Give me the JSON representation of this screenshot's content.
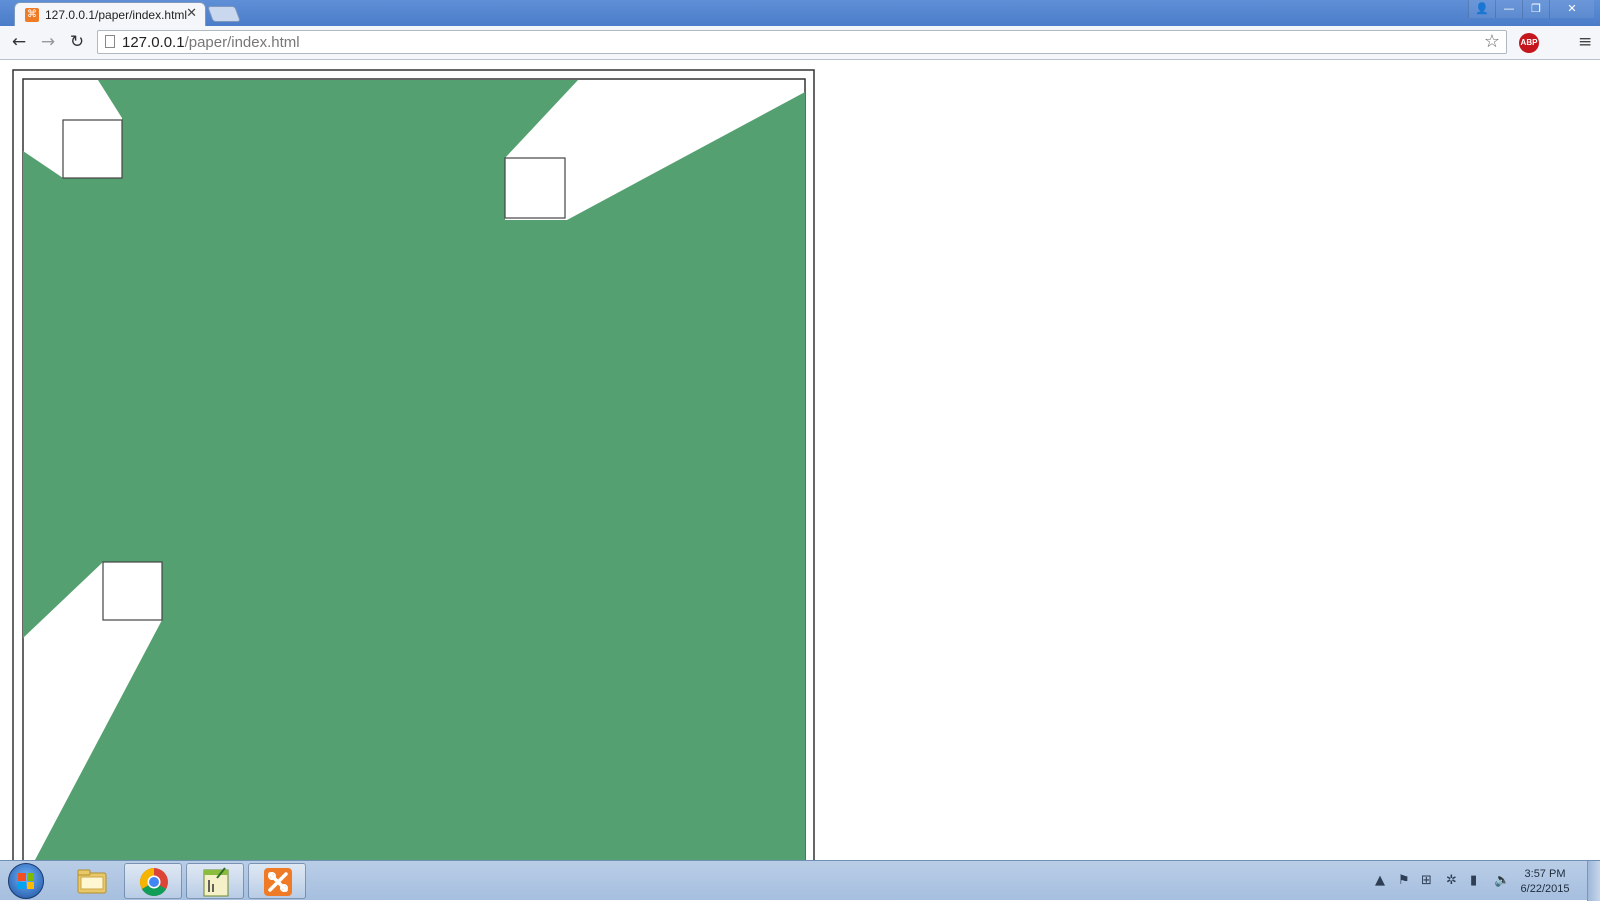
{
  "browser": {
    "tab": {
      "title": "127.0.0.1/paper/index.html",
      "favicon": "xampp-icon",
      "close_glyph": "✕"
    },
    "window_controls": {
      "profile_glyph": "👤",
      "minimize_glyph": "—",
      "restore_glyph": "❐",
      "close_glyph": "✕"
    },
    "toolbar": {
      "back_glyph": "←",
      "forward_glyph": "→",
      "reload_glyph": "↻",
      "url_host": "127.0.0.1",
      "url_path": "/paper/index.html",
      "star_glyph": "☆",
      "abp_label": "ABP",
      "menu_glyph": "≡"
    }
  },
  "page": {
    "background_color": "#ffffff",
    "green_color": "#55a070",
    "border_color": "#333333"
  },
  "taskbar": {
    "apps": [
      {
        "name": "windows-explorer",
        "icon": "folder-icon"
      },
      {
        "name": "google-chrome",
        "icon": "chrome-icon",
        "active": true
      },
      {
        "name": "notepad-plus",
        "icon": "editor-icon",
        "active": true
      },
      {
        "name": "xampp",
        "icon": "xampp-icon",
        "active": true
      }
    ],
    "tray": {
      "arrow_glyph": "▲",
      "flag_glyph": "⚑",
      "windows_glyph": "⊞",
      "sync_glyph": "✲",
      "network_glyph": "▮",
      "volume_glyph": "🔈"
    },
    "clock": {
      "time": "3:57 PM",
      "date": "6/22/2015"
    }
  }
}
